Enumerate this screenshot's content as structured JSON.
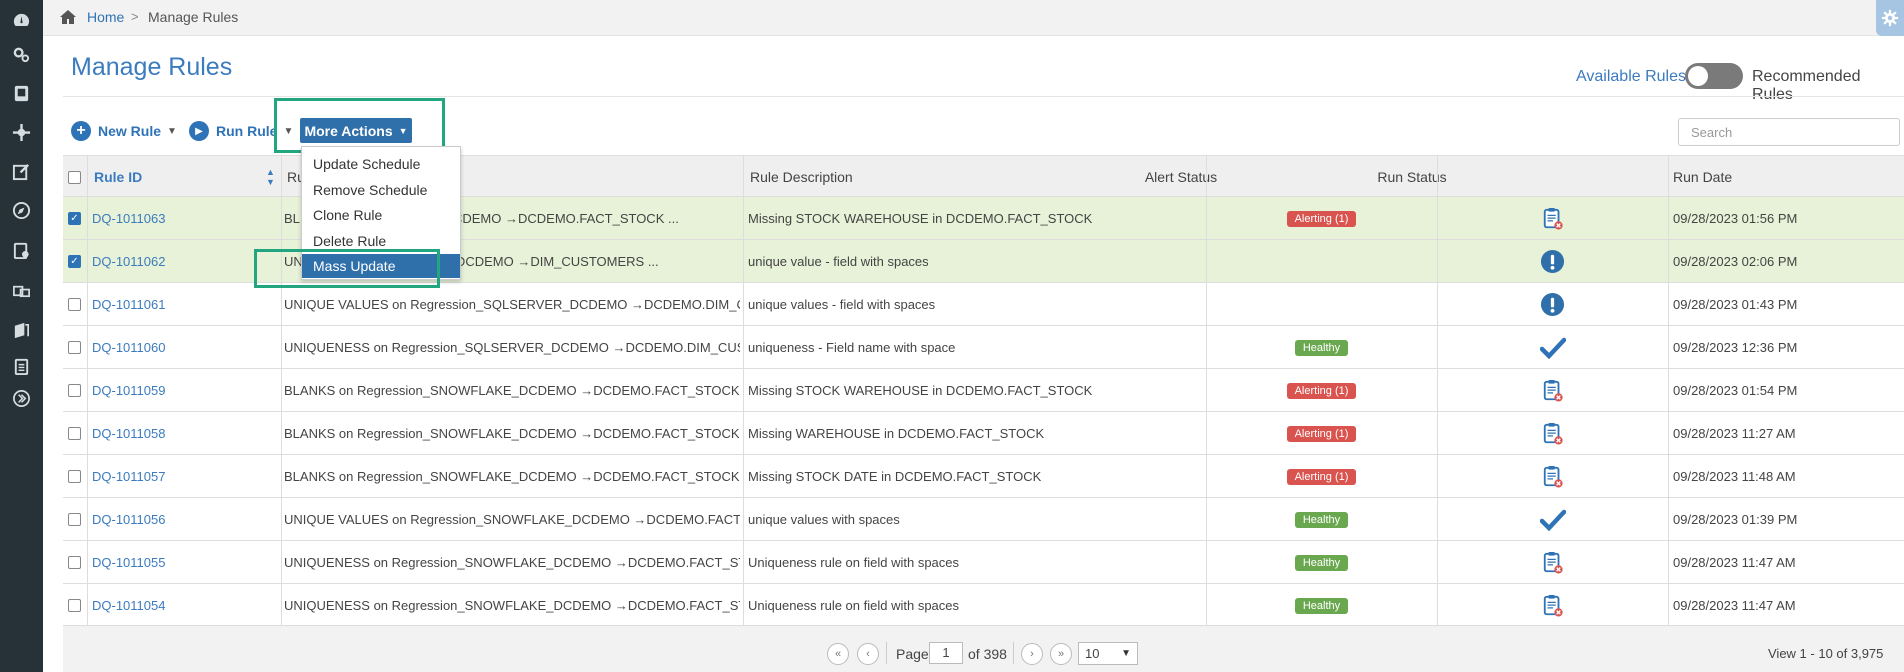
{
  "breadcrumb": {
    "home": "Home",
    "separator": ">",
    "current": "Manage Rules"
  },
  "page": {
    "title": "Manage Rules"
  },
  "toggle": {
    "left_label": "Available Rules",
    "right_label": "Recommended Rules"
  },
  "toolbar": {
    "new_rule": "New Rule",
    "run_rule": "Run Rule",
    "more_actions": "More Actions",
    "search_placeholder": "Search"
  },
  "menu": {
    "items": [
      "Update Schedule",
      "Remove Schedule",
      "Clone Rule",
      "Delete Rule",
      "Mass Update"
    ],
    "active": "Mass Update"
  },
  "table": {
    "headers": {
      "rule_id": "Rule ID",
      "rule_name": "Ru",
      "description": "Rule Description",
      "alert_status": "Alert Status",
      "run_status": "Run Status",
      "run_date": "Run Date"
    },
    "rows": [
      {
        "id": "DQ-1011063",
        "name": "BL",
        "name2": "WFLAKE_DCDEMO →DCDEMO.FACT_STOCK ...",
        "desc": "Missing STOCK WAREHOUSE in DCDEMO.FACT_STOCK",
        "alert": "Alerting (1)",
        "alert_type": "alert",
        "run_icon": "clipboard-error-icon",
        "date": "09/28/2023 01:56 PM",
        "checked": true
      },
      {
        "id": "DQ-1011062",
        "name": "UN",
        "name2": "n_ORACLE_DCDEMO →DIM_CUSTOMERS ...",
        "desc": "unique value - field with spaces",
        "alert": "",
        "alert_type": "none",
        "run_icon": "exclamation-icon",
        "date": "09/28/2023 02:06 PM",
        "checked": true
      },
      {
        "id": "DQ-1011061",
        "name": "UNIQUE VALUES on Regression_SQLSERVER_DCDEMO →DCDEMO.DIM_C...",
        "name2": "",
        "desc": "unique values - field with spaces",
        "alert": "",
        "alert_type": "none",
        "run_icon": "exclamation-icon",
        "date": "09/28/2023 01:43 PM",
        "checked": false
      },
      {
        "id": "DQ-1011060",
        "name": "UNIQUENESS on Regression_SQLSERVER_DCDEMO →DCDEMO.DIM_CUS...",
        "name2": "",
        "desc": "uniqueness -  Field name with space",
        "alert": "Healthy",
        "alert_type": "healthy",
        "run_icon": "checkmark-icon",
        "date": "09/28/2023 12:36 PM",
        "checked": false
      },
      {
        "id": "DQ-1011059",
        "name": "BLANKS on Regression_SNOWFLAKE_DCDEMO →DCDEMO.FACT_STOCK ...",
        "name2": "",
        "desc": "Missing STOCK WAREHOUSE in DCDEMO.FACT_STOCK",
        "alert": "Alerting (1)",
        "alert_type": "alert",
        "run_icon": "clipboard-error-icon",
        "date": "09/28/2023 01:54 PM",
        "checked": false
      },
      {
        "id": "DQ-1011058",
        "name": "BLANKS on Regression_SNOWFLAKE_DCDEMO →DCDEMO.FACT_STOCK ...",
        "name2": "",
        "desc": "Missing WAREHOUSE in DCDEMO.FACT_STOCK",
        "alert": "Alerting (1)",
        "alert_type": "alert",
        "run_icon": "clipboard-error-icon",
        "date": "09/28/2023 11:27 AM",
        "checked": false
      },
      {
        "id": "DQ-1011057",
        "name": "BLANKS on Regression_SNOWFLAKE_DCDEMO →DCDEMO.FACT_STOCK ...",
        "name2": "",
        "desc": "Missing STOCK DATE in DCDEMO.FACT_STOCK",
        "alert": "Alerting (1)",
        "alert_type": "alert",
        "run_icon": "clipboard-error-icon",
        "date": "09/28/2023 11:48 AM",
        "checked": false
      },
      {
        "id": "DQ-1011056",
        "name": "UNIQUE VALUES on Regression_SNOWFLAKE_DCDEMO →DCDEMO.FACT...",
        "name2": "",
        "desc": "unique values with spaces",
        "alert": "Healthy",
        "alert_type": "healthy",
        "run_icon": "checkmark-icon",
        "date": "09/28/2023 01:39 PM",
        "checked": false
      },
      {
        "id": "DQ-1011055",
        "name": "UNIQUENESS on Regression_SNOWFLAKE_DCDEMO →DCDEMO.FACT_ST...",
        "name2": "",
        "desc": "Uniqueness rule on field with spaces",
        "alert": "Healthy",
        "alert_type": "healthy",
        "run_icon": "clipboard-error-icon",
        "date": "09/28/2023 11:47 AM",
        "checked": false
      },
      {
        "id": "DQ-1011054",
        "name": "UNIQUENESS on Regression_SNOWFLAKE_DCDEMO →DCDEMO.FACT_ST...",
        "name2": "",
        "desc": "Uniqueness rule on field with spaces",
        "alert": "Healthy",
        "alert_type": "healthy",
        "run_icon": "clipboard-error-icon",
        "date": "09/28/2023 11:47 AM",
        "checked": false
      }
    ]
  },
  "pager": {
    "page_label": "Page",
    "page_value": "1",
    "of_label": "of 398",
    "page_size": "10",
    "view_text": "View 1 - 10 of 3,975"
  },
  "colors": {
    "accent": "#2f73b7",
    "highlight": "#22a67f",
    "alert": "#d9534f",
    "healthy": "#6aa84f",
    "sidebar": "#263238"
  }
}
